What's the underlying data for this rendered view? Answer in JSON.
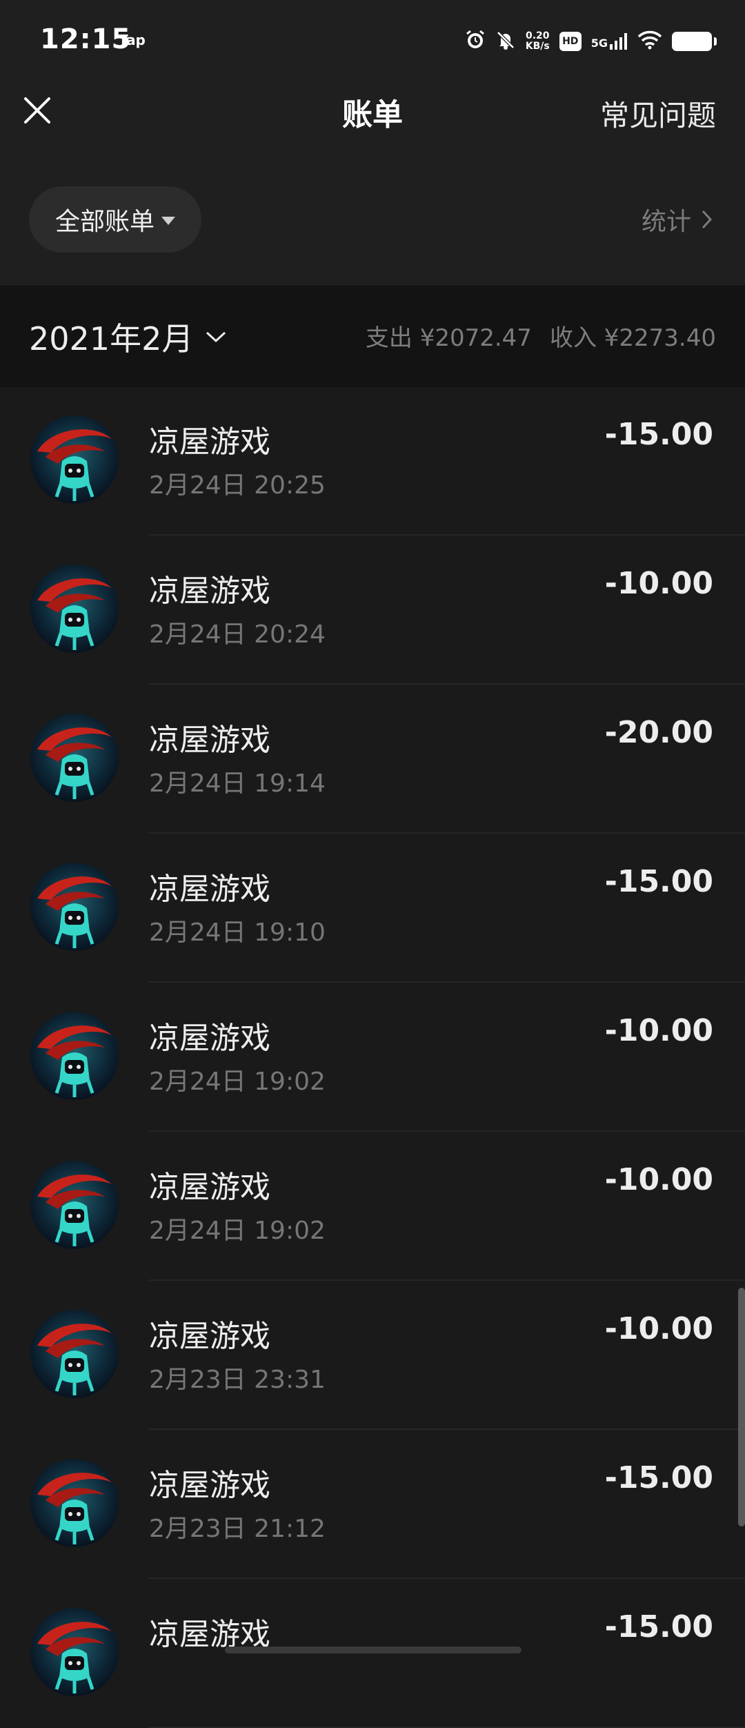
{
  "status_bar": {
    "time": "12:15",
    "app_label": "Tap",
    "net_speed_value": "0.20",
    "net_speed_unit": "KB/s",
    "hd_label": "HD",
    "network_label": "5G"
  },
  "header": {
    "title": "账单",
    "help_link": "常见问题"
  },
  "filter": {
    "dropdown_label": "全部账单",
    "stats_label": "统计"
  },
  "month_summary": {
    "month": "2021年2月",
    "expense": "支出 ¥2072.47",
    "income": "收入 ¥2273.40"
  },
  "transactions": [
    {
      "name": "凉屋游戏",
      "datetime": "2月24日 20:25",
      "amount": "-15.00"
    },
    {
      "name": "凉屋游戏",
      "datetime": "2月24日 20:24",
      "amount": "-10.00"
    },
    {
      "name": "凉屋游戏",
      "datetime": "2月24日 19:14",
      "amount": "-20.00"
    },
    {
      "name": "凉屋游戏",
      "datetime": "2月24日 19:10",
      "amount": "-15.00"
    },
    {
      "name": "凉屋游戏",
      "datetime": "2月24日 19:02",
      "amount": "-10.00"
    },
    {
      "name": "凉屋游戏",
      "datetime": "2月24日 19:02",
      "amount": "-10.00"
    },
    {
      "name": "凉屋游戏",
      "datetime": "2月23日 23:31",
      "amount": "-10.00"
    },
    {
      "name": "凉屋游戏",
      "datetime": "2月23日 21:12",
      "amount": "-15.00"
    },
    {
      "name": "凉屋游戏",
      "datetime": "",
      "amount": "-15.00"
    }
  ],
  "colors": {
    "background": "#1a1a1a",
    "header_bg": "#1f1f1f",
    "month_bar_bg": "#131313",
    "text_primary": "#ededed",
    "text_secondary": "#767676"
  }
}
